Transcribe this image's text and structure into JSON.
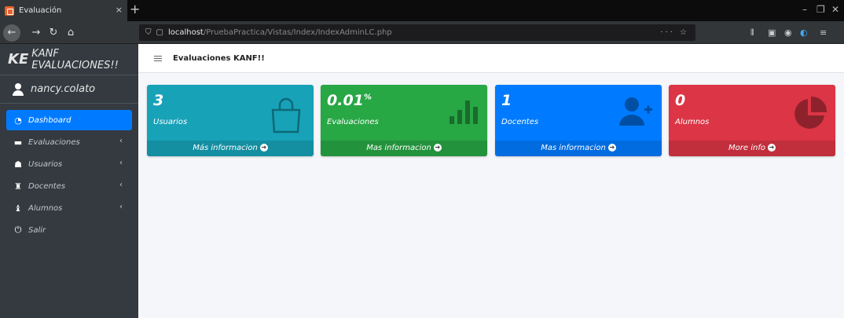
{
  "browser": {
    "tab_title": "Evaluación",
    "tab_close": "×",
    "new_tab": "+",
    "url_host": "localhost",
    "url_path": "/PruebaPractica/Vistas/Index/IndexAdminLC.php",
    "url_actions": "··· ☆",
    "win_min": "–",
    "win_max": "❐",
    "win_close": "✕"
  },
  "sidebar": {
    "brand_logo": "KE",
    "brand_name": "KANF EVALUACIONES!!",
    "user_name": "nancy.colato",
    "items": [
      {
        "label": "Dashboard",
        "icon": "dashboard-icon",
        "glyph": "◔",
        "active": true,
        "chevron": ""
      },
      {
        "label": "Evaluaciones",
        "icon": "folder-icon",
        "glyph": "▬",
        "active": false,
        "chevron": "‹"
      },
      {
        "label": "Usuarios",
        "icon": "users-icon",
        "glyph": "☗",
        "active": false,
        "chevron": "‹"
      },
      {
        "label": "Docentes",
        "icon": "chalkboard-icon",
        "glyph": "♜",
        "active": false,
        "chevron": "‹"
      },
      {
        "label": "Alumnos",
        "icon": "student-icon",
        "glyph": "♝",
        "active": false,
        "chevron": "‹"
      },
      {
        "label": "Salir",
        "icon": "power-icon",
        "glyph": "⏻",
        "active": false,
        "chevron": ""
      }
    ]
  },
  "header": {
    "title": "Evaluaciones KANF!!"
  },
  "boxes": [
    {
      "value": "3",
      "suffix": "",
      "label": "Usuarios",
      "link": "Más informacion",
      "color": "#17a2b8",
      "icon": "shopping-bag-icon"
    },
    {
      "value": "0.01",
      "suffix": "%",
      "label": "Evaluaciones",
      "link": "Mas informacion",
      "color": "#28a745",
      "icon": "bar-chart-icon"
    },
    {
      "value": "1",
      "suffix": "",
      "label": "Docentes",
      "link": "Mas informacion",
      "color": "#007bff",
      "icon": "user-plus-icon"
    },
    {
      "value": "0",
      "suffix": "",
      "label": "Alumnos",
      "link": "More info",
      "color": "#dc3545",
      "icon": "pie-chart-icon"
    }
  ]
}
